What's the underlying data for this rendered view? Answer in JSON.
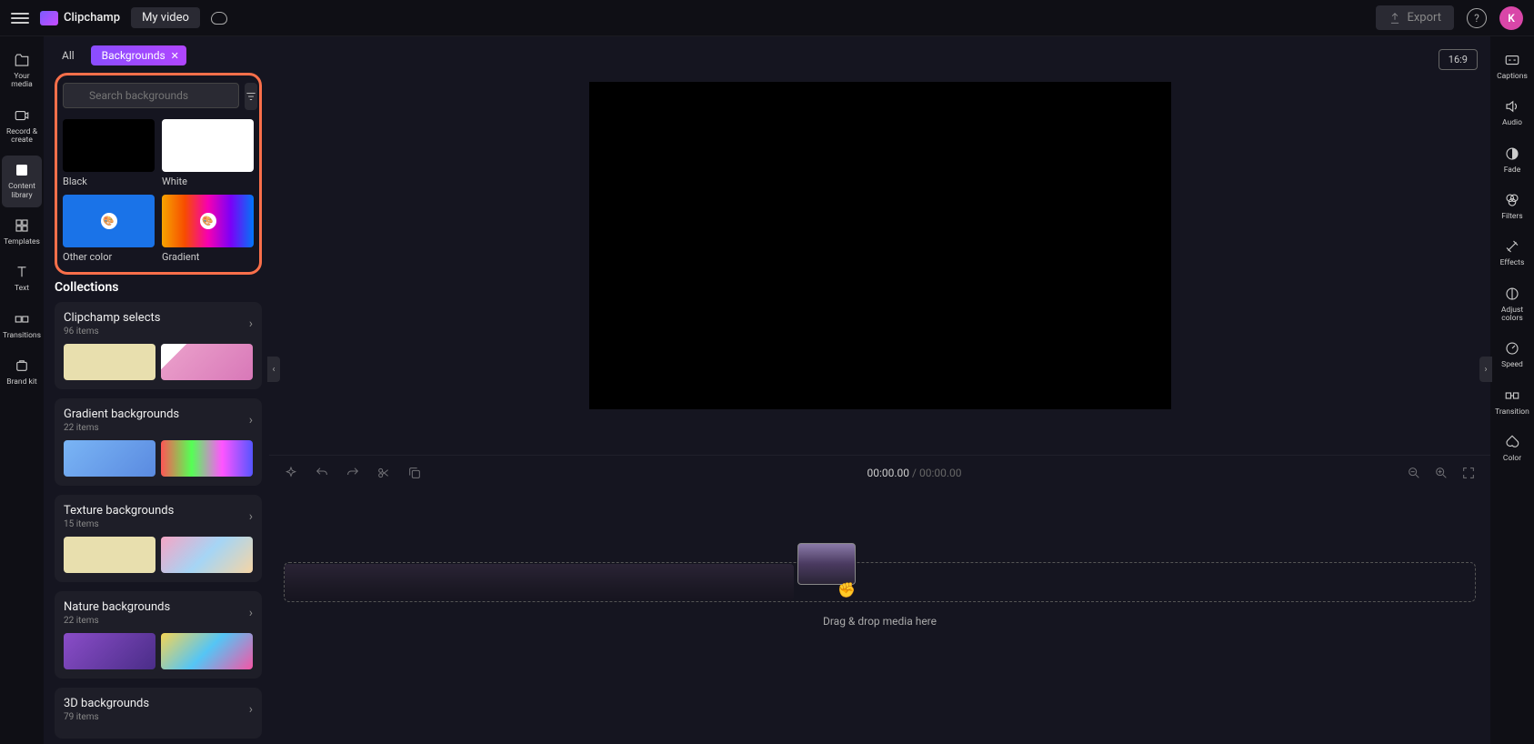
{
  "app": {
    "name": "Clipchamp",
    "project_title": "My video"
  },
  "topbar": {
    "export_label": "Export",
    "avatar_initial": "K"
  },
  "left_rail": [
    {
      "label": "Your media"
    },
    {
      "label": "Record & create"
    },
    {
      "label": "Content library"
    },
    {
      "label": "Templates"
    },
    {
      "label": "Text"
    },
    {
      "label": "Transitions"
    },
    {
      "label": "Brand kit"
    }
  ],
  "panel": {
    "tab_all": "All",
    "tab_active": "Backgrounds",
    "search_placeholder": "Search backgrounds",
    "swatches": [
      {
        "label": "Black",
        "bg": "#000000"
      },
      {
        "label": "White",
        "bg": "#ffffff"
      },
      {
        "label": "Other color",
        "bg": "#1a73e8"
      },
      {
        "label": "Gradient",
        "bg": "linear-gradient(90deg,#f7a400,#f74d00,#f700b0,#7b00f7,#0077f7)"
      }
    ],
    "collections_title": "Collections",
    "collections": [
      {
        "title": "Clipchamp selects",
        "count": "96 items",
        "t1": "#e8dfae",
        "t2": "linear-gradient(135deg,#fff 0%,#fff 20%,#e89ac8 20%,#d878b8 100%)"
      },
      {
        "title": "Gradient backgrounds",
        "count": "22 items",
        "t1": "linear-gradient(135deg,#7ab5f5,#5a8ae0)",
        "t2": "linear-gradient(90deg,#f55,#5f5,#f5f,#55f)"
      },
      {
        "title": "Texture backgrounds",
        "count": "15 items",
        "t1": "#e8dfae",
        "t2": "linear-gradient(135deg,#f5a5c5,#a5d5f5,#f5d5a5)"
      },
      {
        "title": "Nature backgrounds",
        "count": "22 items",
        "t1": "linear-gradient(135deg,#8a4dc8,#4a2d88)",
        "t2": "linear-gradient(135deg,#f5d555,#55c5f5,#f555a5)"
      },
      {
        "title": "3D backgrounds",
        "count": "79 items",
        "t1": "#333",
        "t2": "#333"
      }
    ]
  },
  "preview": {
    "aspect": "16:9"
  },
  "timeline": {
    "current": "00:00.00",
    "total": "00:00.00",
    "drop_label": "Drag & drop media here"
  },
  "right_rail": [
    {
      "label": "Captions"
    },
    {
      "label": "Audio"
    },
    {
      "label": "Fade"
    },
    {
      "label": "Filters"
    },
    {
      "label": "Effects"
    },
    {
      "label": "Adjust colors"
    },
    {
      "label": "Speed"
    },
    {
      "label": "Transition"
    },
    {
      "label": "Color"
    }
  ]
}
